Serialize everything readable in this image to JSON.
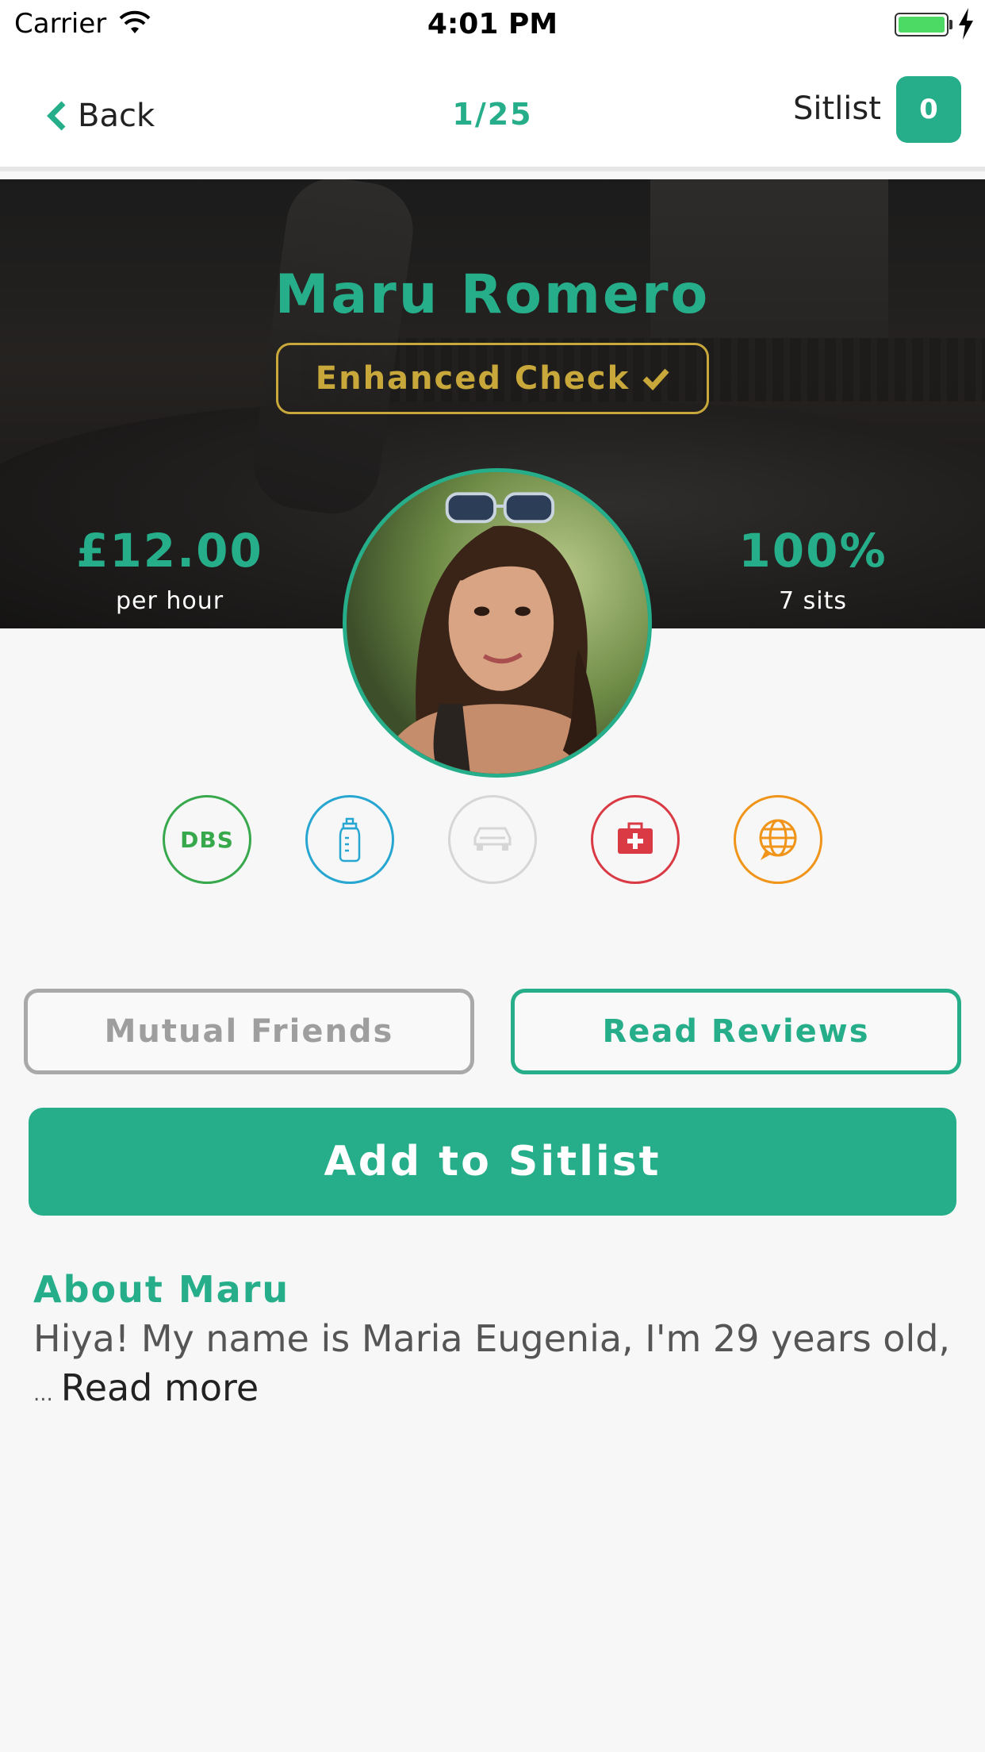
{
  "status_bar": {
    "carrier": "Carrier",
    "time": "4:01 PM"
  },
  "nav": {
    "back_label": "Back",
    "counter": "1/25",
    "sitlist_label": "Sitlist",
    "sitlist_count": "0"
  },
  "profile": {
    "name": "Maru Romero",
    "check_badge": "Enhanced Check",
    "price": "£12.00",
    "price_unit": "per hour",
    "rating": "100%",
    "sits": "7 sits"
  },
  "features": [
    {
      "icon": "dbs-icon",
      "label": "DBS",
      "color": "#37a84b"
    },
    {
      "icon": "baby-bottle-icon",
      "color": "#26a6d1"
    },
    {
      "icon": "car-icon",
      "color": "#d6d6d6"
    },
    {
      "icon": "first-aid-kit-icon",
      "color": "#d93a44"
    },
    {
      "icon": "language-globe-icon",
      "color": "#f0941a"
    }
  ],
  "actions": {
    "mutual_friends": "Mutual Friends",
    "read_reviews": "Read Reviews",
    "add_to_sitlist": "Add to Sitlist"
  },
  "about": {
    "title": "About Maru",
    "text": "Hiya! My name is Maria Eugenia, I'm 29 years old,",
    "ellipsis": "...",
    "read_more": "Read more"
  },
  "colors": {
    "accent": "#26ae8a",
    "badge_gold": "#c8a83a"
  }
}
